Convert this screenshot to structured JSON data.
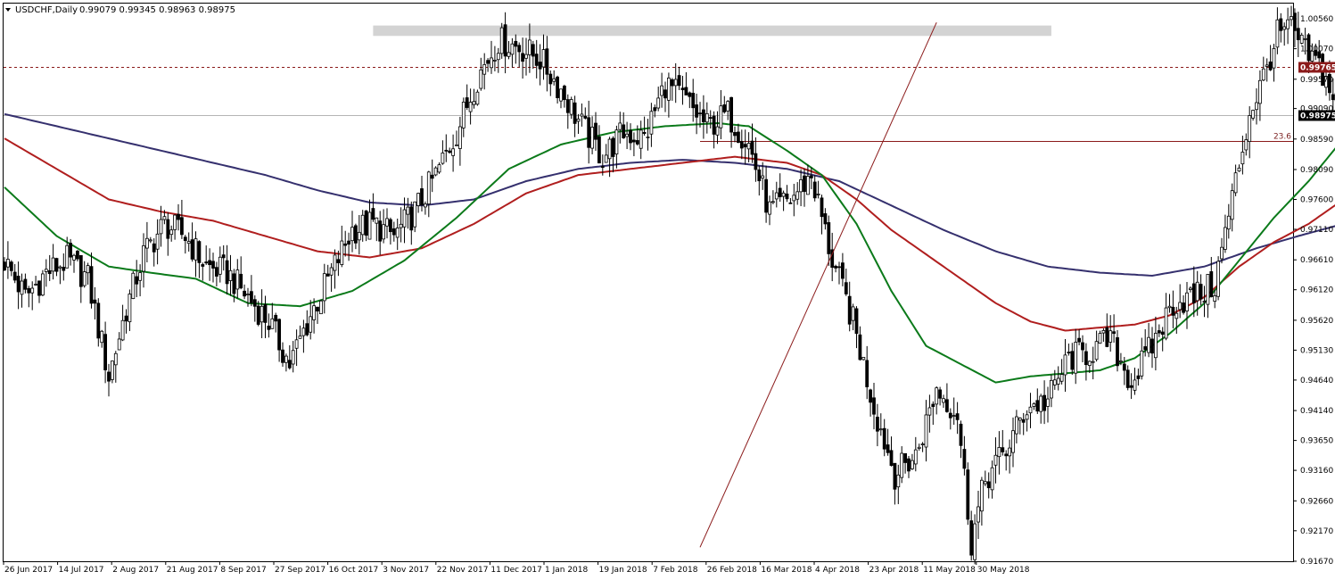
{
  "header": {
    "symbol": "USDCHF,Daily",
    "ohlc": "0.99079 0.99345 0.98963 0.98975"
  },
  "chart_data": {
    "type": "candlestick",
    "timeframe": "Daily",
    "ylim": [
      0.9167,
      1.0081
    ],
    "y_ticks": [
      "1.00560",
      "1.00070",
      "0.99570",
      "0.99090",
      "0.98590",
      "0.98090",
      "0.97600",
      "0.97110",
      "0.96610",
      "0.96120",
      "0.95620",
      "0.95130",
      "0.94640",
      "0.94140",
      "0.93650",
      "0.93160",
      "0.92660",
      "0.92170",
      "0.91670"
    ],
    "x_ticks": [
      "26 Jun 2017",
      "14 Jul 2017",
      "2 Aug 2017",
      "21 Aug 2017",
      "8 Sep 2017",
      "27 Sep 2017",
      "16 Oct 2017",
      "3 Nov 2017",
      "22 Nov 2017",
      "11 Dec 2017",
      "1 Jan 2018",
      "19 Jan 2018",
      "7 Feb 2018",
      "26 Feb 2018",
      "16 Mar 2018",
      "4 Apr 2018",
      "23 Apr 2018",
      "11 May 2018",
      "30 May 2018"
    ],
    "anchors": [
      [
        0,
        0.966
      ],
      [
        6,
        0.96
      ],
      [
        12,
        0.964
      ],
      [
        18,
        0.966
      ],
      [
        24,
        0.963
      ],
      [
        30,
        0.947
      ],
      [
        35,
        0.958
      ],
      [
        40,
        0.967
      ],
      [
        46,
        0.972
      ],
      [
        52,
        0.97
      ],
      [
        58,
        0.965
      ],
      [
        64,
        0.964
      ],
      [
        70,
        0.96
      ],
      [
        76,
        0.956
      ],
      [
        82,
        0.949
      ],
      [
        88,
        0.957
      ],
      [
        94,
        0.964
      ],
      [
        100,
        0.971
      ],
      [
        106,
        0.972
      ],
      [
        112,
        0.97
      ],
      [
        118,
        0.974
      ],
      [
        124,
        0.98
      ],
      [
        130,
        0.987
      ],
      [
        136,
        0.996
      ],
      [
        142,
        1.002
      ],
      [
        148,
        1.001
      ],
      [
        154,
        0.999
      ],
      [
        160,
        0.994
      ],
      [
        166,
        0.988
      ],
      [
        172,
        0.983
      ],
      [
        178,
        0.987
      ],
      [
        184,
        0.986
      ],
      [
        190,
        0.995
      ],
      [
        196,
        0.992
      ],
      [
        202,
        0.988
      ],
      [
        208,
        0.99
      ],
      [
        214,
        0.985
      ],
      [
        220,
        0.974
      ],
      [
        226,
        0.976
      ],
      [
        232,
        0.98
      ],
      [
        238,
        0.966
      ],
      [
        244,
        0.956
      ],
      [
        250,
        0.942
      ],
      [
        256,
        0.931
      ],
      [
        262,
        0.934
      ],
      [
        268,
        0.945
      ],
      [
        274,
        0.941
      ],
      [
        278,
        0.92
      ],
      [
        282,
        0.93
      ],
      [
        288,
        0.935
      ],
      [
        294,
        0.942
      ],
      [
        300,
        0.943
      ],
      [
        306,
        0.95
      ],
      [
        312,
        0.951
      ],
      [
        318,
        0.953
      ],
      [
        324,
        0.946
      ],
      [
        330,
        0.952
      ],
      [
        336,
        0.959
      ],
      [
        342,
        0.96
      ],
      [
        348,
        0.962
      ],
      [
        354,
        0.979
      ],
      [
        358,
        0.99
      ],
      [
        362,
        0.996
      ],
      [
        366,
        1.003
      ],
      [
        370,
        1.004
      ],
      [
        374,
        1.0
      ],
      [
        378,
        0.998
      ],
      [
        382,
        0.993
      ],
      [
        385,
        0.99
      ]
    ],
    "sma_green": {
      "color": "#0b7a1a",
      "points": [
        [
          0,
          0.978
        ],
        [
          15,
          0.97
        ],
        [
          30,
          0.965
        ],
        [
          42,
          0.964
        ],
        [
          55,
          0.963
        ],
        [
          70,
          0.959
        ],
        [
          85,
          0.9585
        ],
        [
          100,
          0.961
        ],
        [
          115,
          0.966
        ],
        [
          130,
          0.973
        ],
        [
          145,
          0.981
        ],
        [
          160,
          0.985
        ],
        [
          175,
          0.987
        ],
        [
          190,
          0.988
        ],
        [
          205,
          0.9885
        ],
        [
          214,
          0.988
        ],
        [
          225,
          0.984
        ],
        [
          235,
          0.98
        ],
        [
          245,
          0.972
        ],
        [
          255,
          0.961
        ],
        [
          265,
          0.952
        ],
        [
          275,
          0.949
        ],
        [
          285,
          0.946
        ],
        [
          295,
          0.947
        ],
        [
          305,
          0.9475
        ],
        [
          315,
          0.948
        ],
        [
          325,
          0.95
        ],
        [
          335,
          0.954
        ],
        [
          345,
          0.959
        ],
        [
          355,
          0.966
        ],
        [
          365,
          0.973
        ],
        [
          375,
          0.979
        ],
        [
          385,
          0.986
        ]
      ]
    },
    "sma_red": {
      "color": "#b01e1e",
      "points": [
        [
          0,
          0.986
        ],
        [
          15,
          0.981
        ],
        [
          30,
          0.976
        ],
        [
          45,
          0.974
        ],
        [
          60,
          0.9725
        ],
        [
          75,
          0.97
        ],
        [
          90,
          0.9675
        ],
        [
          105,
          0.9665
        ],
        [
          120,
          0.968
        ],
        [
          135,
          0.972
        ],
        [
          150,
          0.977
        ],
        [
          165,
          0.98
        ],
        [
          180,
          0.981
        ],
        [
          195,
          0.982
        ],
        [
          210,
          0.983
        ],
        [
          225,
          0.982
        ],
        [
          235,
          0.98
        ],
        [
          245,
          0.976
        ],
        [
          255,
          0.971
        ],
        [
          265,
          0.967
        ],
        [
          275,
          0.963
        ],
        [
          285,
          0.959
        ],
        [
          295,
          0.956
        ],
        [
          305,
          0.9545
        ],
        [
          315,
          0.955
        ],
        [
          325,
          0.9555
        ],
        [
          335,
          0.957
        ],
        [
          345,
          0.96
        ],
        [
          355,
          0.965
        ],
        [
          365,
          0.969
        ],
        [
          375,
          0.972
        ],
        [
          385,
          0.976
        ]
      ]
    },
    "sma_blue": {
      "color": "#35306e",
      "points": [
        [
          0,
          0.99
        ],
        [
          15,
          0.988
        ],
        [
          30,
          0.986
        ],
        [
          45,
          0.984
        ],
        [
          60,
          0.982
        ],
        [
          75,
          0.98
        ],
        [
          90,
          0.9775
        ],
        [
          105,
          0.9755
        ],
        [
          120,
          0.975
        ],
        [
          135,
          0.976
        ],
        [
          150,
          0.979
        ],
        [
          165,
          0.981
        ],
        [
          180,
          0.982
        ],
        [
          195,
          0.9825
        ],
        [
          210,
          0.982
        ],
        [
          225,
          0.981
        ],
        [
          240,
          0.979
        ],
        [
          255,
          0.975
        ],
        [
          270,
          0.971
        ],
        [
          285,
          0.9675
        ],
        [
          300,
          0.965
        ],
        [
          315,
          0.964
        ],
        [
          330,
          0.9635
        ],
        [
          345,
          0.965
        ],
        [
          360,
          0.968
        ],
        [
          372,
          0.97
        ],
        [
          385,
          0.972
        ]
      ]
    },
    "resistance_zone": {
      "from": 1.0028,
      "to": 1.0045,
      "bar_start": 106,
      "bar_end": 301
    },
    "dotted_level": {
      "value": 0.99765,
      "label": "0.99765",
      "color": "#8b1a1a"
    },
    "current_price": {
      "value": 0.98975,
      "label": "0.98975"
    },
    "fib_line": {
      "value": 0.9855,
      "label": "23.6",
      "bar_start": 200,
      "color": "#8b1a1a"
    },
    "trend_line": {
      "from": [
        200,
        0.919
      ],
      "to": [
        268,
        1.005
      ],
      "color": "#8b1a1a"
    }
  }
}
